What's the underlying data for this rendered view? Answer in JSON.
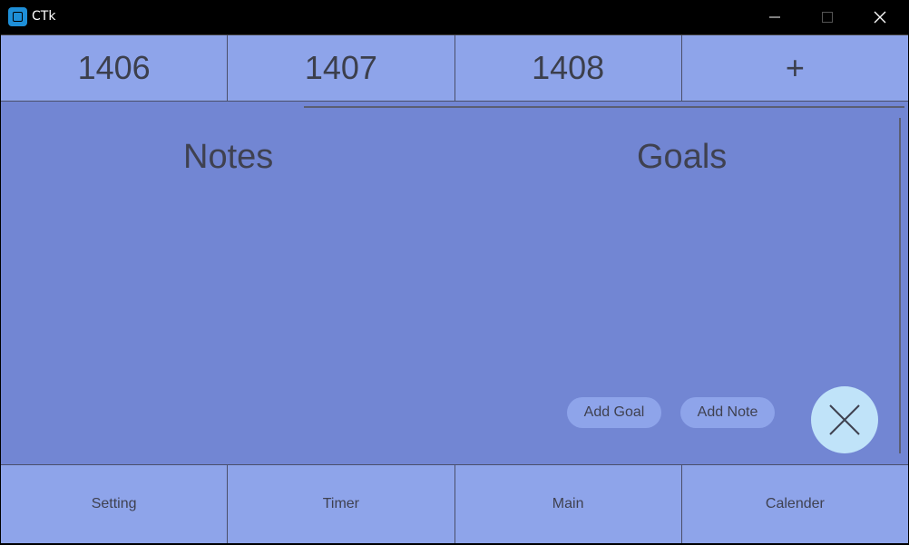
{
  "window": {
    "title": "CTk",
    "icon": "app-icon",
    "controls": [
      "minimize-icon",
      "maximize-icon",
      "close-icon"
    ]
  },
  "tabs": [
    {
      "label": "1406"
    },
    {
      "label": "1407"
    },
    {
      "label": "1408"
    },
    {
      "label": "+"
    }
  ],
  "main": {
    "notes_title": "Notes",
    "goals_title": "Goals",
    "add_goal_label": "Add Goal",
    "add_note_label": "Add Note",
    "close_button_icon": "close-x-icon"
  },
  "bottom_nav": [
    {
      "label": "Setting"
    },
    {
      "label": "Timer"
    },
    {
      "label": "Main"
    },
    {
      "label": "Calender"
    }
  ],
  "colors": {
    "titlebar": "#000000",
    "tab_bg": "#8ea4ea",
    "main_bg": "#7286d3",
    "fab_bg": "#c0e3f9",
    "text": "#3f4150"
  }
}
